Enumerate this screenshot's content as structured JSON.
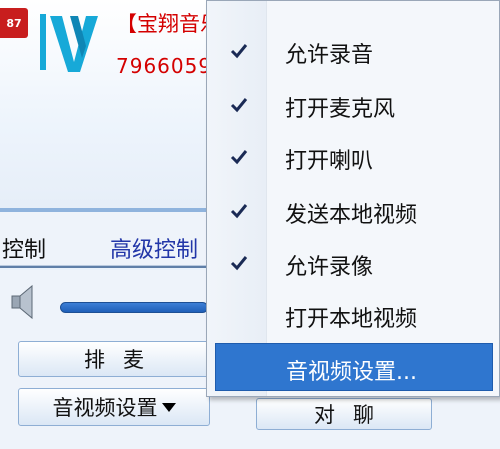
{
  "header": {
    "badge": "87",
    "room_title": "【宝翔音乐】小意艺子",
    "room_id": "7966059"
  },
  "tabs": {
    "control": "控制",
    "advanced": "高级控制"
  },
  "buttons": {
    "queue": "排麦",
    "av_settings": "音视频设置",
    "private_chat": "对聊"
  },
  "volume": {
    "level": 1.0
  },
  "context_menu": {
    "items": [
      {
        "label": "允许录音",
        "checked": true
      },
      {
        "label": "打开麦克风",
        "checked": true
      },
      {
        "label": "打开喇叭",
        "checked": true
      },
      {
        "label": "发送本地视频",
        "checked": true
      },
      {
        "label": "允许录像",
        "checked": true
      },
      {
        "label": "打开本地视频",
        "checked": false
      },
      {
        "label": "音视频设置...",
        "checked": false,
        "highlighted": true
      }
    ]
  },
  "colors": {
    "accent": "#2f76cf",
    "title_red": "#d40000",
    "tab_blue": "#2236a8"
  }
}
